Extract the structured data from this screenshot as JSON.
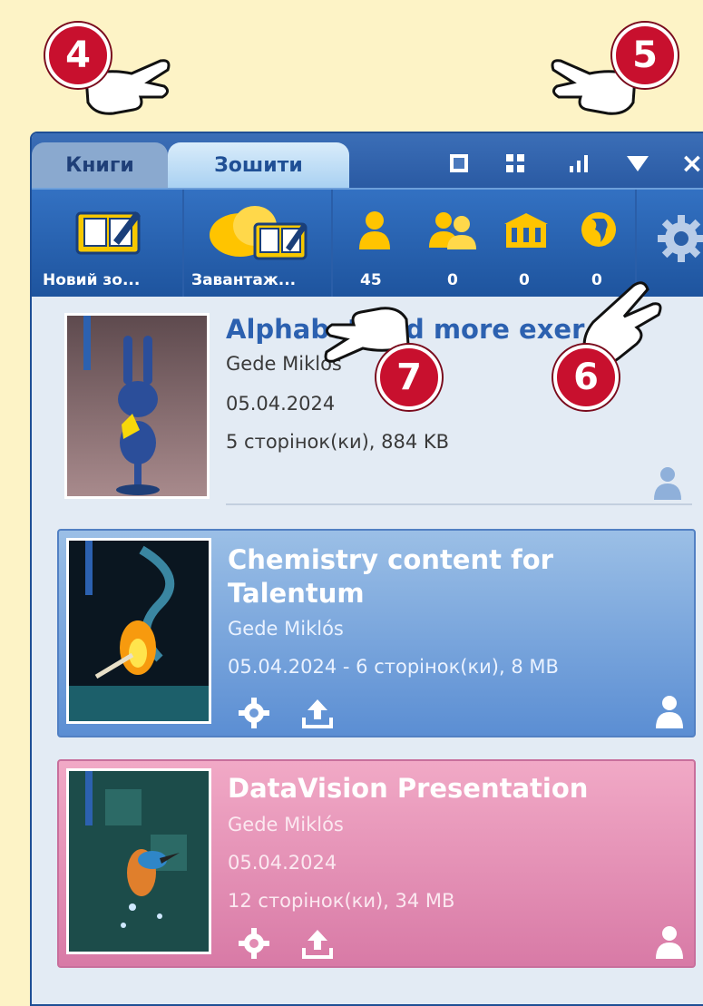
{
  "tabs": [
    {
      "label": "Книги",
      "active": false
    },
    {
      "label": "Зошити",
      "active": true
    }
  ],
  "window_controls": [
    "single-view-icon",
    "grid-view-icon",
    "signal-bars-icon",
    "dropdown-arrow-icon",
    "close-icon"
  ],
  "close_glyph": "×",
  "toolbar": {
    "new_notebook_label": "Новий зо...",
    "download_label": "Завантаж...",
    "counters": [
      {
        "icon": "single-user-icon",
        "value": "45"
      },
      {
        "icon": "group-users-icon",
        "value": "0"
      },
      {
        "icon": "school-icon",
        "value": "0"
      },
      {
        "icon": "globe-icon",
        "value": "0"
      }
    ],
    "settings_icon": "gear-icon"
  },
  "cards": [
    {
      "title": "Alphabet and more exer",
      "author": "Gede Miklós",
      "date": "05.04.2024",
      "info": "5 сторінок(ки), 884 KB",
      "share": "single-user-icon"
    },
    {
      "title": "Chemistry content for Talentum",
      "author": "Gede Miklós",
      "date_info": "05.04.2024 - 6 сторінок(ки), 8 MB",
      "share": "single-user-icon"
    },
    {
      "title": "DataVision Presentation",
      "author": "Gede Miklós",
      "date": "05.04.2024",
      "info": "12 сторінок(ки), 34 MB",
      "share": "single-user-icon"
    }
  ],
  "callouts": [
    "4",
    "5",
    "6",
    "7"
  ],
  "colors": {
    "background": "#fdf3c6",
    "toolbar": "#2a5fa8",
    "card_blue": "#6f9bd9",
    "card_pink": "#e28bb3",
    "callout": "#c8102e"
  }
}
